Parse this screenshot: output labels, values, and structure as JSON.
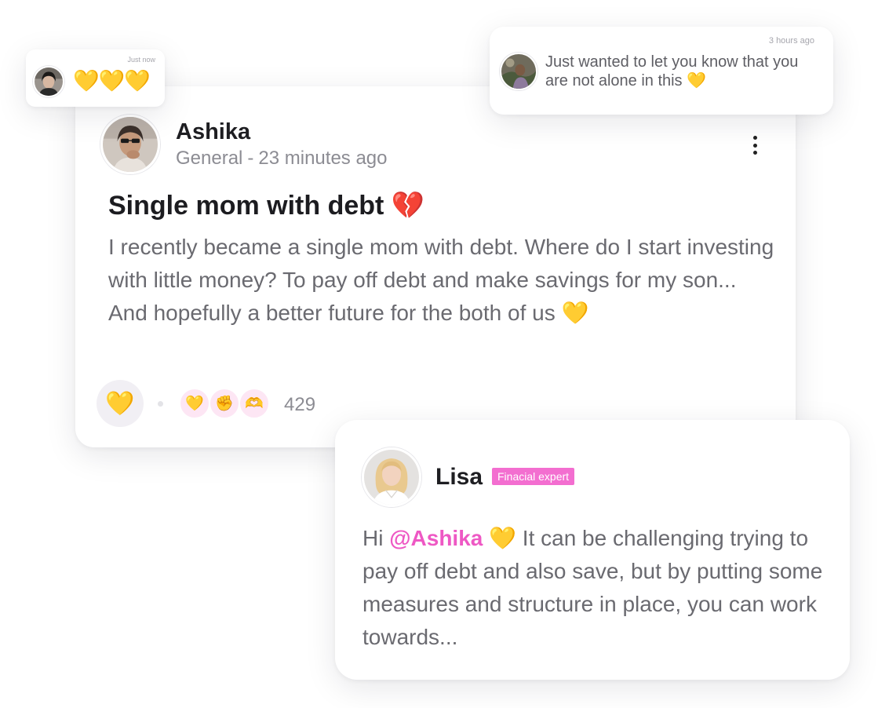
{
  "post": {
    "author": "Ashika",
    "category": "General",
    "separator": "-",
    "time_ago": "23 minutes ago",
    "title": "Single mom with debt",
    "title_emoji": "💔",
    "body": "I recently became a single mom with debt. Where do I start investing with little money? To pay off debt and make savings for my son... And hopefully a better future for the both of us",
    "body_emoji": "💛",
    "react_emoji": "💛",
    "reactions": [
      "💛",
      "✊",
      "🫶"
    ],
    "reaction_count": "429"
  },
  "mini_comment": {
    "time": "Just now",
    "emojis": "💛💛💛"
  },
  "note_comment": {
    "time": "3 hours ago",
    "text": "Just wanted to let you know that you are not alone in this",
    "emoji": "💛"
  },
  "reply": {
    "author": "Lisa",
    "badge": "Finacial expert",
    "greeting": "Hi",
    "mention": "@Ashika",
    "emoji": "💛",
    "body": "It can be challenging trying to pay off debt and also save, but by putting some measures and structure in place, you can work towards..."
  },
  "colors": {
    "accent_pink": "#ee58c4",
    "badge_pink": "#f36ed0",
    "reaction_bg": "#fde6f4",
    "muted_text": "#8c8c93"
  }
}
